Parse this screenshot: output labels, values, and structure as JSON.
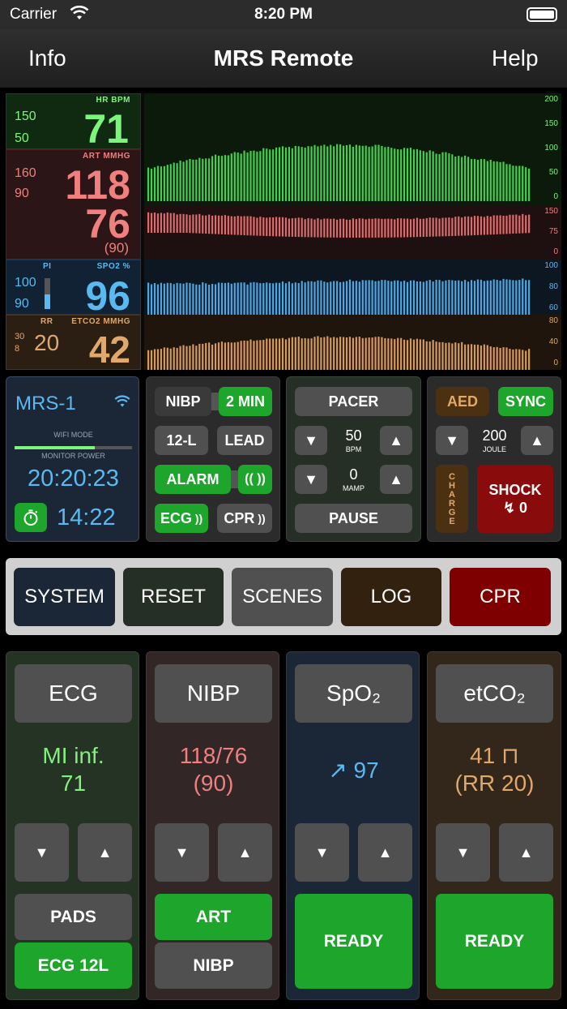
{
  "status": {
    "carrier": "Carrier",
    "time": "8:20 PM"
  },
  "nav": {
    "left": "Info",
    "title": "MRS Remote",
    "right": "Help"
  },
  "vitals": {
    "hr": {
      "tag": "HR  BPM",
      "hi": "150",
      "lo": "50",
      "value": "71",
      "color": "#7cf57c"
    },
    "art": {
      "tag": "ART  MMHG",
      "hi": "160",
      "lo": "90",
      "sys": "118",
      "dia": "76",
      "map": "(90)",
      "color": "#f07f7f"
    },
    "spo2": {
      "tag_pi": "PI",
      "tag": "SPO2  %",
      "hi": "100",
      "lo": "90",
      "value": "96",
      "color": "#5ab9f0"
    },
    "etco2": {
      "tag_rr": "RR",
      "tag": "ETCO2  MMHG",
      "hi": "30",
      "lo": "8",
      "rr": "20",
      "value": "42",
      "color": "#e0a86a"
    }
  },
  "scales": {
    "hr": [
      "200",
      "150",
      "100",
      "50",
      "0"
    ],
    "art": [
      "150",
      "75",
      "0"
    ],
    "spo2": [
      "100",
      "80",
      "60"
    ],
    "co2": [
      "80",
      "40",
      "0"
    ]
  },
  "device": {
    "name": "MRS-1",
    "wifi_mode": "WIFI MODE",
    "monitor_power": "MONITOR POWER",
    "clock": "20:20:23",
    "timer": "14:22",
    "power_level": 0.68
  },
  "mode_panel": {
    "nibp": "NIBP",
    "interval": "2 MIN",
    "lead12": "12-L",
    "lead": "LEAD",
    "alarm": "ALARM",
    "ecg": "ECG",
    "cpr": "CPR"
  },
  "pacer": {
    "title": "PACER",
    "rate": "50",
    "rate_unit": "BPM",
    "amp": "0",
    "amp_unit": "MAMP",
    "pause": "PAUSE"
  },
  "defib": {
    "aed": "AED",
    "sync": "SYNC",
    "energy": "200",
    "energy_unit": "JOULE",
    "charge": "CHARGE",
    "shock": "SHOCK",
    "shock_count": "↯ 0"
  },
  "tabs": [
    {
      "label": "SYSTEM",
      "color": "#1b2637"
    },
    {
      "label": "RESET",
      "color": "#262f26"
    },
    {
      "label": "SCENES",
      "color": "#505050"
    },
    {
      "label": "LOG",
      "color": "#33210f"
    },
    {
      "label": "CPR",
      "color": "#7e0000"
    }
  ],
  "columns": {
    "ecg": {
      "title": "ECG",
      "line1": "MI inf.",
      "line2": "71",
      "b1": "PADS",
      "b2": "ECG 12L",
      "bg": "#243324",
      "color": "#86ee7e"
    },
    "nibp": {
      "title": "NIBP",
      "line1": "118/76",
      "line2": "(90)",
      "b1": "ART",
      "b2": "NIBP",
      "bg": "#332627",
      "color": "#f07f7f"
    },
    "spo2": {
      "title": "SpO₂",
      "line1": "↗ 97",
      "b1": "READY",
      "bg": "#1b2637",
      "color": "#5ab9f0"
    },
    "etco2": {
      "title": "etCO₂",
      "line1": "41  ⊓",
      "line2": "(RR 20)",
      "b1": "READY",
      "bg": "#33261a",
      "color": "#e0a86a"
    }
  },
  "arrows": {
    "down": "▼",
    "up": "▲"
  }
}
